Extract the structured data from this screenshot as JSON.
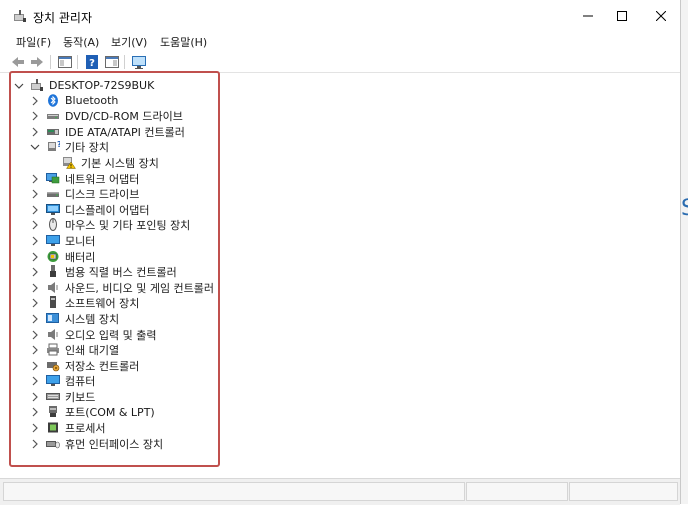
{
  "window": {
    "title": "장치 관리자",
    "controls": {
      "minimize": "minimize",
      "maximize": "maximize",
      "close": "close"
    }
  },
  "menu": [
    {
      "label": "파일(F)"
    },
    {
      "label": "동작(A)"
    },
    {
      "label": "보기(V)"
    },
    {
      "label": "도움말(H)"
    }
  ],
  "toolbar": {
    "buttons": [
      "back-icon",
      "forward-icon",
      "properties-pane-icon",
      "help-icon",
      "view-icon",
      "monitor-scan-icon"
    ]
  },
  "tree": {
    "root": {
      "label": "DESKTOP-72S9BUK",
      "expanded": true
    },
    "items": [
      {
        "label": "Bluetooth",
        "icon": "bluetooth-icon",
        "expanded": false,
        "level": 1
      },
      {
        "label": "DVD/CD-ROM 드라이브",
        "icon": "dvd-drive-icon",
        "expanded": false,
        "level": 1
      },
      {
        "label": "IDE ATA/ATAPI 컨트롤러",
        "icon": "ide-controller-icon",
        "expanded": false,
        "level": 1
      },
      {
        "label": "기타 장치",
        "icon": "other-devices-icon",
        "expanded": true,
        "level": 1
      },
      {
        "label": "기본 시스템 장치",
        "icon": "warning-device-icon",
        "level": 2
      },
      {
        "label": "네트워크 어댑터",
        "icon": "network-adapter-icon",
        "expanded": false,
        "level": 1
      },
      {
        "label": "디스크 드라이브",
        "icon": "disk-drive-icon",
        "expanded": false,
        "level": 1
      },
      {
        "label": "디스플레이 어댑터",
        "icon": "display-adapter-icon",
        "expanded": false,
        "level": 1
      },
      {
        "label": "마우스 및 기타 포인팅 장치",
        "icon": "mouse-icon",
        "expanded": false,
        "level": 1
      },
      {
        "label": "모니터",
        "icon": "monitor-icon",
        "expanded": false,
        "level": 1
      },
      {
        "label": "배터리",
        "icon": "battery-icon",
        "expanded": false,
        "level": 1
      },
      {
        "label": "범용 직렬 버스 컨트롤러",
        "icon": "usb-icon",
        "expanded": false,
        "level": 1
      },
      {
        "label": "사운드, 비디오 및 게임 컨트롤러",
        "icon": "sound-icon",
        "expanded": false,
        "level": 1
      },
      {
        "label": "소프트웨어 장치",
        "icon": "software-device-icon",
        "expanded": false,
        "level": 1
      },
      {
        "label": "시스템 장치",
        "icon": "system-device-icon",
        "expanded": false,
        "level": 1
      },
      {
        "label": "오디오 입력 및 출력",
        "icon": "audio-io-icon",
        "expanded": false,
        "level": 1
      },
      {
        "label": "인쇄 대기열",
        "icon": "printer-icon",
        "expanded": false,
        "level": 1
      },
      {
        "label": "저장소 컨트롤러",
        "icon": "storage-controller-icon",
        "expanded": false,
        "level": 1
      },
      {
        "label": "컴퓨터",
        "icon": "computer-icon",
        "expanded": false,
        "level": 1
      },
      {
        "label": "키보드",
        "icon": "keyboard-icon",
        "expanded": false,
        "level": 1
      },
      {
        "label": "포트(COM & LPT)",
        "icon": "port-icon",
        "expanded": false,
        "level": 1
      },
      {
        "label": "프로세서",
        "icon": "processor-icon",
        "expanded": false,
        "level": 1
      },
      {
        "label": "휴먼 인터페이스 장치",
        "icon": "hid-icon",
        "expanded": false,
        "level": 1
      }
    ]
  },
  "colors": {
    "highlight_box": "#c0504d",
    "accent": "#0078d7"
  }
}
